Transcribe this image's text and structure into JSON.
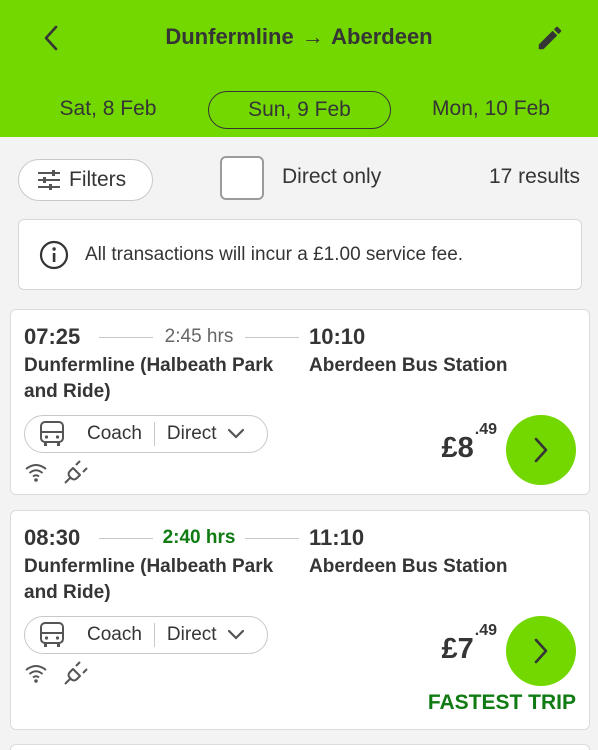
{
  "header": {
    "origin": "Dunfermline",
    "arrow": "→",
    "destination": "Aberdeen",
    "dates": {
      "prev": "Sat, 8 Feb",
      "current": "Sun, 9 Feb",
      "next": "Mon, 10 Feb"
    }
  },
  "toolbar": {
    "filters_label": "Filters",
    "direct_only_label": "Direct only",
    "results_count": "17 results"
  },
  "notice": {
    "text": "All transactions will incur a £1.00 service fee."
  },
  "trips": [
    {
      "departure_time": "07:25",
      "duration": "2:45 hrs",
      "arrival_time": "10:10",
      "departure_station": "Dunfermline (Halbeath Park and Ride)",
      "arrival_station": "Aberdeen Bus Station",
      "vehicle": "Coach",
      "connection": "Direct",
      "price_main": "£8",
      "price_decimal": ".49",
      "badge": ""
    },
    {
      "departure_time": "08:30",
      "duration": "2:40 hrs",
      "arrival_time": "11:10",
      "departure_station": "Dunfermline (Halbeath Park and Ride)",
      "arrival_station": "Aberdeen Bus Station",
      "vehicle": "Coach",
      "connection": "Direct",
      "price_main": "£7",
      "price_decimal": ".49",
      "badge": "FASTEST TRIP"
    }
  ],
  "colors": {
    "brand": "#73d700",
    "highlight": "#0f7b12",
    "text": "#353535"
  },
  "icons": [
    "back-arrow-icon",
    "pencil-icon",
    "filter-sliders-icon",
    "info-icon",
    "bus-icon",
    "chevron-down-icon",
    "wifi-icon",
    "power-plug-icon",
    "chevron-right-icon"
  ]
}
